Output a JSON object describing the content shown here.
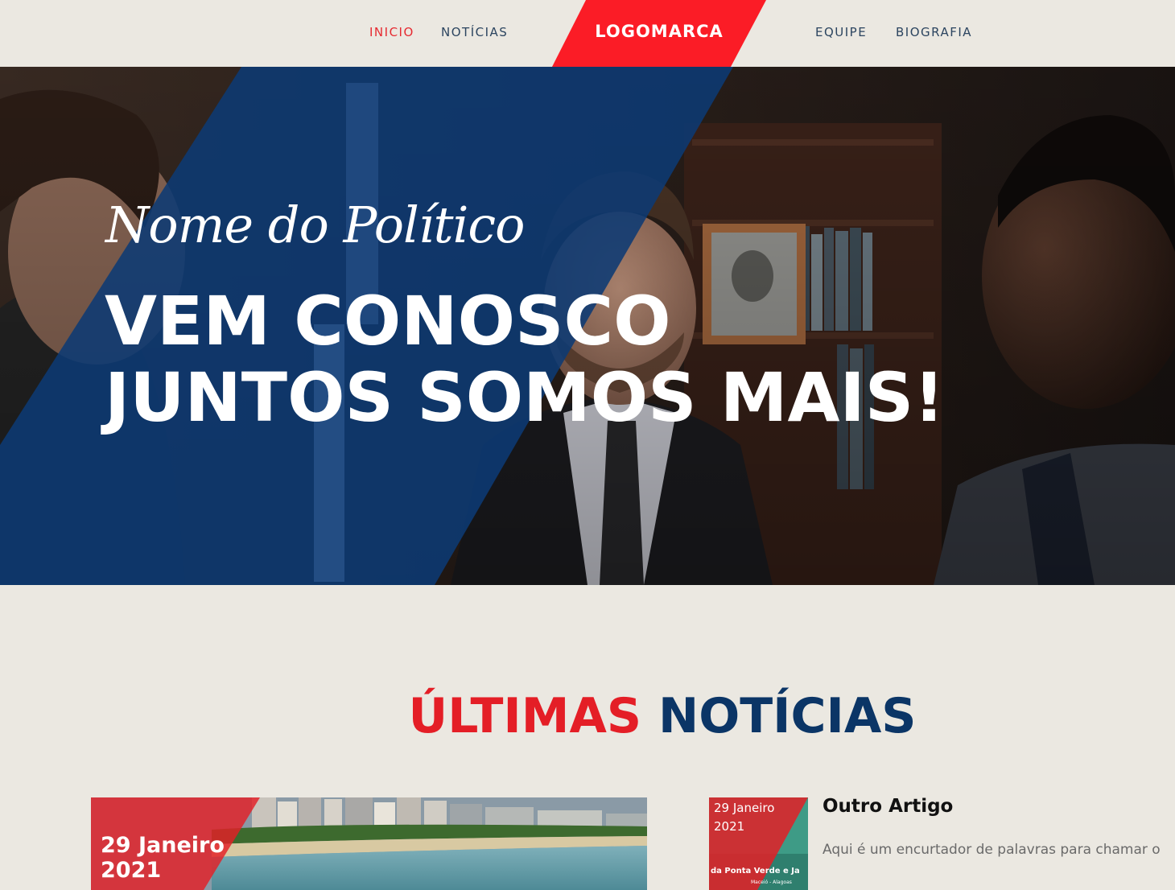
{
  "colors": {
    "background": "#ebe8e1",
    "accent_red": "#e41e26",
    "brand_blue": "#0b3566",
    "nav_text": "#2c4560"
  },
  "header": {
    "nav_left": [
      {
        "label": "INICIO",
        "active": true
      },
      {
        "label": "NOTÍCIAS",
        "active": false
      }
    ],
    "logo_text": "LOGOMARCA",
    "nav_right": [
      {
        "label": "EQUIPE",
        "active": false
      },
      {
        "label": "BIOGRAFIA",
        "active": false
      }
    ]
  },
  "hero": {
    "script_name": "Nome do Político",
    "headline_line1": "VEM CONOSCO",
    "headline_line2": "JUNTOS SOMOS MAIS!"
  },
  "news": {
    "title_part1": "ÚLTIMAS",
    "title_part2": "NOTÍCIAS",
    "featured": {
      "date": "29 Janeiro 2021",
      "date_line1": "29 Janeiro",
      "date_line2": "2021"
    },
    "articles": [
      {
        "date_line1": "29 Janeiro",
        "date_line2": "2021",
        "thumb_caption": "da Ponta Verde e Ja",
        "thumb_subcaption": "Maceió - Alagoas",
        "title": "Outro Artigo",
        "excerpt": "Aqui é um encurtador de palavras para chamar o"
      }
    ]
  }
}
